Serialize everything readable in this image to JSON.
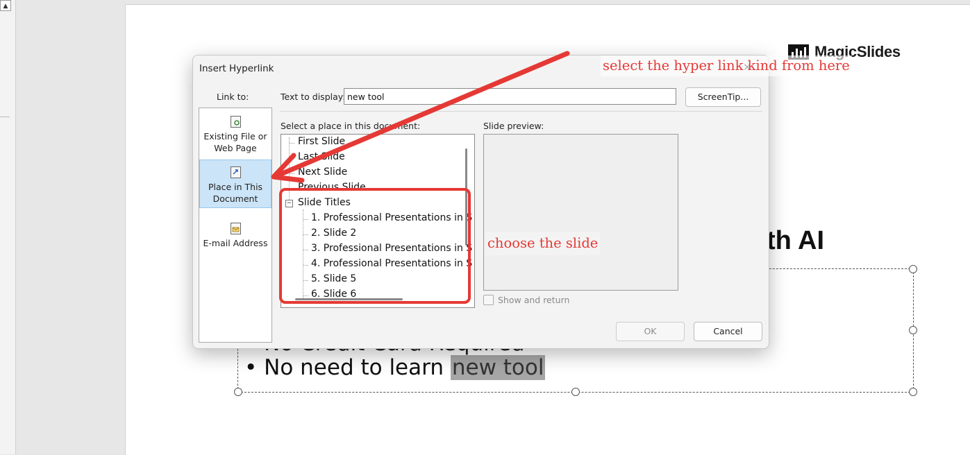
{
  "colors": {
    "annotation": "#e53935",
    "selection": "#cce4f7",
    "selection_border": "#99c8ef"
  },
  "slide": {
    "logo_text": "MagicSlides",
    "title_fragment": "th AI",
    "bullet_partial": "• No Credit Card Required",
    "bullet_main": "• No need to learn ",
    "bullet_highlight": "new tool"
  },
  "dialog": {
    "title": "Insert Hyperlink",
    "help_glyph": "?",
    "close_glyph": "✕",
    "link_to_label": "Link to:",
    "link_to_items": [
      {
        "label": "Existing File or Web Page",
        "icon": "web-page-icon",
        "selected": false
      },
      {
        "label": "Place in This Document",
        "icon": "document-place-icon",
        "selected": true
      },
      {
        "label": "E-mail Address",
        "icon": "email-icon",
        "selected": false
      }
    ],
    "text_to_display_label": "Text to display:",
    "text_to_display_value": "new tool",
    "screentip_label": "ScreenTip...",
    "place_label": "Select a place in this document:",
    "tree": {
      "top_items": [
        "First Slide",
        "Last Slide",
        "Next Slide",
        "Previous Slide"
      ],
      "group_label": "Slide Titles",
      "group_toggle": "−",
      "slides": [
        "1. Professional Presentations in S",
        "2. Slide 2",
        "3. Professional Presentations in S",
        "4. Professional Presentations in S",
        "5. Slide 5",
        "6. Slide 6"
      ]
    },
    "preview_label": "Slide preview:",
    "show_and_return_label": "Show and return",
    "ok_label": "OK",
    "cancel_label": "Cancel"
  },
  "annotations": {
    "top_note": "select the hyper link kind from here",
    "choose_note": "choose the slide"
  }
}
